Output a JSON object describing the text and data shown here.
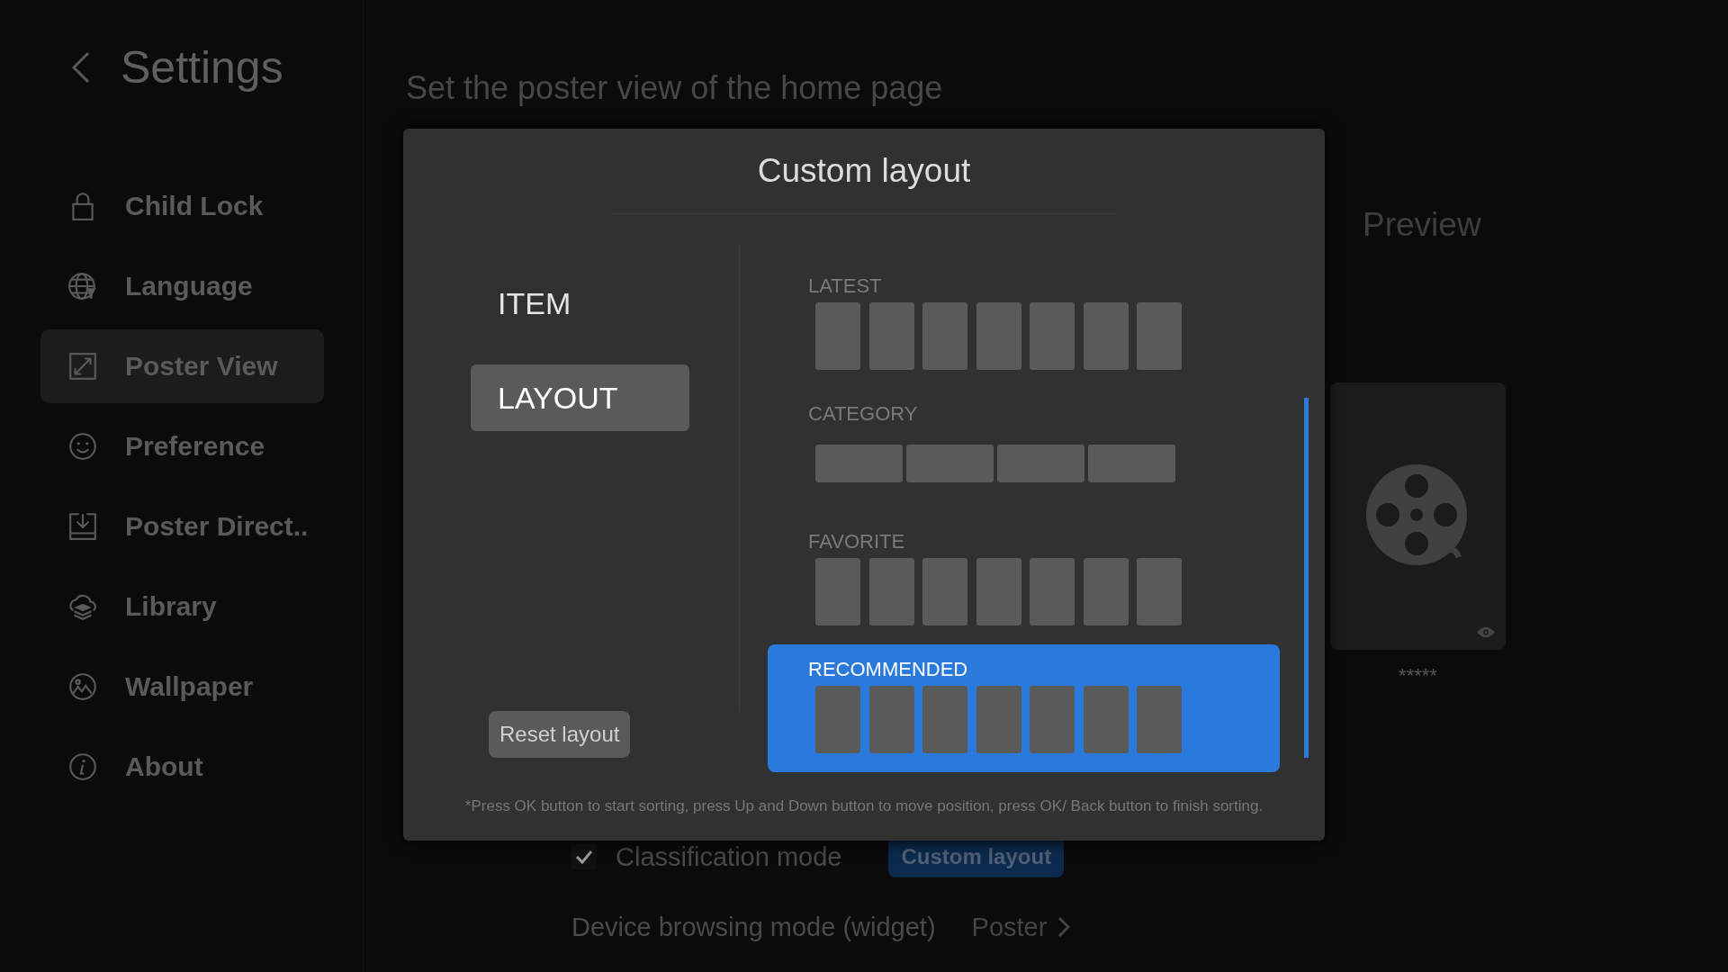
{
  "sidebar": {
    "title": "Settings",
    "items": [
      {
        "label": "Child Lock",
        "kind": "lock",
        "selected": false
      },
      {
        "label": "Language",
        "kind": "globe",
        "selected": false
      },
      {
        "label": "Poster View",
        "kind": "expand",
        "selected": true
      },
      {
        "label": "Preference",
        "kind": "smile",
        "selected": false
      },
      {
        "label": "Poster Direct..",
        "kind": "download",
        "selected": false
      },
      {
        "label": "Library",
        "kind": "layers",
        "selected": false
      },
      {
        "label": "Wallpaper",
        "kind": "picture",
        "selected": false
      },
      {
        "label": "About",
        "kind": "info",
        "selected": false
      }
    ]
  },
  "page": {
    "heading": "Set the poster view of the home page",
    "preview": {
      "title": "Preview",
      "caption": "*****"
    },
    "options": [
      {
        "kind": "checkbox",
        "label": "Classification mode",
        "checked": true,
        "button": "Custom layout"
      },
      {
        "kind": "link",
        "label": "Device browsing mode (widget)",
        "value": "Poster"
      }
    ]
  },
  "dialog": {
    "title": "Custom layout",
    "tabs": [
      {
        "label": "ITEM",
        "selected": false
      },
      {
        "label": "LAYOUT",
        "selected": true
      }
    ],
    "reset_button": "Reset layout",
    "sections": [
      {
        "label": "LATEST",
        "kind": "portrait",
        "selected": false
      },
      {
        "label": "CATEGORY",
        "kind": "landscape",
        "selected": false
      },
      {
        "label": "FAVORITE",
        "kind": "portrait",
        "selected": false
      },
      {
        "label": "RECOMMENDED",
        "kind": "portrait",
        "selected": true
      }
    ],
    "note": "*Press OK button to start sorting, press Up and Down button to move position, press OK/ Back button to finish sorting."
  }
}
